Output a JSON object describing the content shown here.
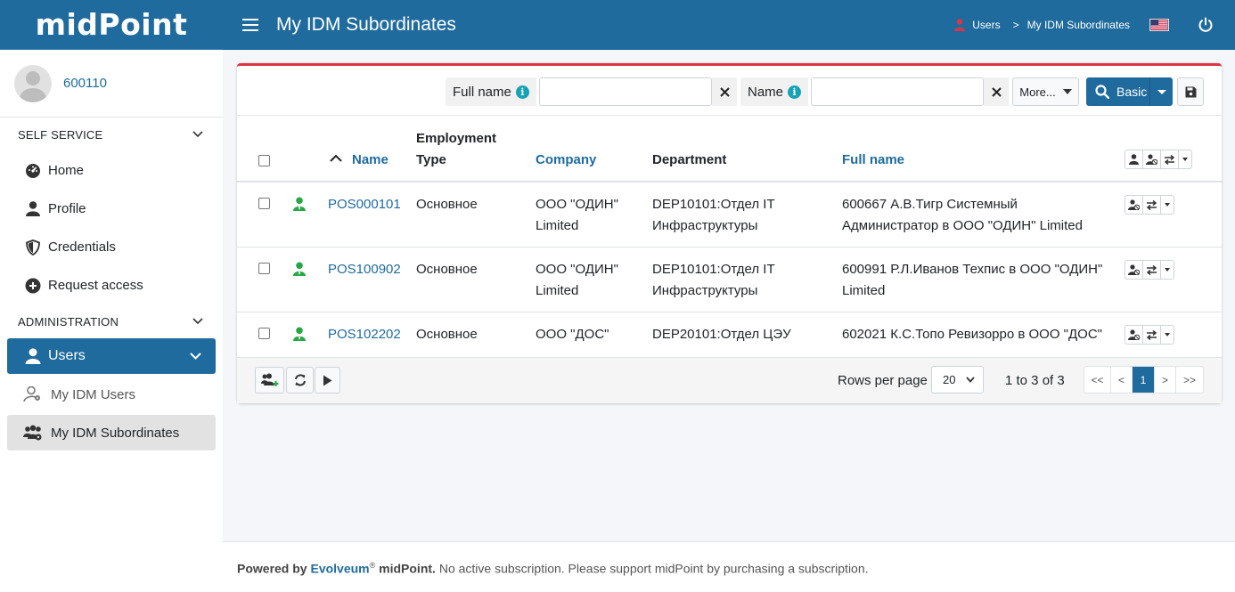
{
  "header": {
    "brand": "midPoint",
    "page_title": "My IDM Subordinates",
    "breadcrumb": [
      "Users",
      "My IDM Subordinates"
    ],
    "breadcrumb_sep": ">"
  },
  "sidebar": {
    "user": "600110",
    "self_service": {
      "title": "SELF SERVICE",
      "items": [
        "Home",
        "Profile",
        "Credentials",
        "Request access"
      ]
    },
    "administration": {
      "title": "ADMINISTRATION",
      "users_label": "Users",
      "sub_items": [
        "My IDM Users",
        "My IDM Subordinates"
      ]
    }
  },
  "search": {
    "fullname_label": "Full name",
    "fullname_value": "",
    "name_label": "Name",
    "name_value": "",
    "more_label": "More...",
    "basic_label": "Basic"
  },
  "table": {
    "columns": {
      "name": "Name",
      "employment_type": [
        "Employment",
        "Type"
      ],
      "company": "Company",
      "department": "Department",
      "full_name": "Full name"
    },
    "rows": [
      {
        "name": "POS000101",
        "employment": "Основное",
        "company": [
          "ООО \"ОДИН\"",
          "Limited"
        ],
        "department": [
          "DEP10101:Отдел IT",
          "Инфраструктуры"
        ],
        "full_name": [
          "600667 А.В.Тигр Системный",
          "Администратор в ООО \"ОДИН\" Limited"
        ]
      },
      {
        "name": "POS100902",
        "employment": "Основное",
        "company": [
          "ООО \"ОДИН\"",
          "Limited"
        ],
        "department": [
          "DEP10101:Отдел IT",
          "Инфраструктуры"
        ],
        "full_name": [
          "600991 Р.Л.Иванов Техпис в ООО \"ОДИН\"",
          "Limited"
        ]
      },
      {
        "name": "POS102202",
        "employment": "Основное",
        "company": [
          "ООО \"ДОС\""
        ],
        "department": [
          "DEP20101:Отдел ЦЭУ"
        ],
        "full_name": [
          "602021 К.С.Топо Ревизорро в ООО \"ДОС\""
        ]
      }
    ]
  },
  "paging": {
    "rows_per_page_label": "Rows per page",
    "rows_per_page": "20",
    "count_text": "1 to 3 of 3",
    "buttons": [
      "<<",
      "<",
      "1",
      ">",
      ">>"
    ],
    "current_page": "1"
  },
  "footer": {
    "powered_by": "Powered by",
    "company": "Evolveum",
    "reg": "®",
    "product": "midPoint.",
    "message": "No active subscription. Please support midPoint by purchasing a subscription."
  },
  "colors": {
    "primary": "#1f6b9e",
    "danger": "#dc3545",
    "success": "#28a745",
    "info": "#17a2b8"
  }
}
